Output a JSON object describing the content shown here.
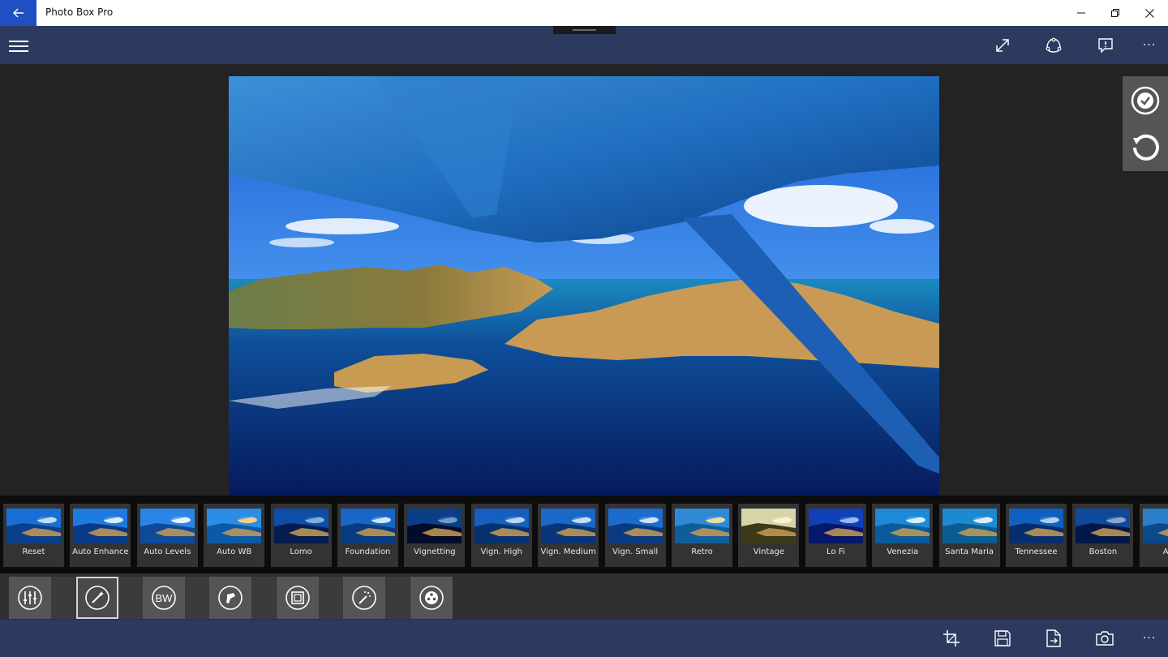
{
  "window": {
    "title": "Photo Box Pro",
    "accent": "#1f4fc3"
  },
  "appbar": {
    "color": "#2b3a5e",
    "icons": [
      "hamburger-menu-icon",
      "fullscreen-icon",
      "share-icon",
      "feedback-icon",
      "more-icon"
    ],
    "more_label": "···"
  },
  "side_panel": {
    "icons": [
      "apply-check-icon",
      "undo-icon"
    ]
  },
  "filters": [
    {
      "label": "Reset"
    },
    {
      "label": "Auto Enhance"
    },
    {
      "label": "Auto Levels"
    },
    {
      "label": "Auto WB"
    },
    {
      "label": "Lomo"
    },
    {
      "label": "Foundation"
    },
    {
      "label": "Vignetting"
    },
    {
      "label": "Vign. High"
    },
    {
      "label": "Vign. Medium"
    },
    {
      "label": "Vign. Small"
    },
    {
      "label": "Retro"
    },
    {
      "label": "Vintage"
    },
    {
      "label": "Lo Fi"
    },
    {
      "label": "Venezia"
    },
    {
      "label": "Santa Maria"
    },
    {
      "label": "Tennessee"
    },
    {
      "label": "Boston"
    },
    {
      "label": "Ant"
    }
  ],
  "tools": {
    "bw_label": "BW",
    "icons": [
      "adjustments-icon",
      "magic-wand-icon",
      "bw-icon",
      "paint-sprayer-icon",
      "frame-icon",
      "sparkle-wand-icon",
      "film-reel-icon"
    ]
  },
  "bottombar": {
    "icons": [
      "crop-icon",
      "save-icon",
      "export-icon",
      "camera-icon",
      "more-icon"
    ],
    "more_label": "···"
  }
}
